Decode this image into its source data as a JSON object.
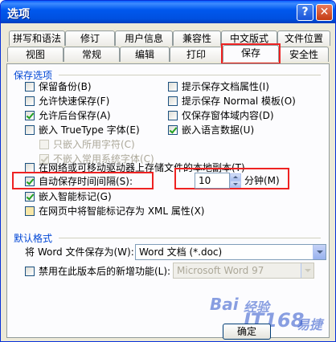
{
  "window": {
    "title": "选项",
    "help_glyph": "?",
    "close_glyph": "✕"
  },
  "tabs_row1": [
    "拼写和语法",
    "修订",
    "用户信息",
    "兼容性",
    "中文版式",
    "文件位置"
  ],
  "tabs_row2": [
    "视图",
    "常规",
    "编辑",
    "打印",
    "保存",
    "安全性"
  ],
  "active_tab": "保存",
  "save_options": {
    "group_title": "保存选项",
    "left": [
      {
        "label": "保留备份(B)",
        "checked": false,
        "disabled": false
      },
      {
        "label": "允许快速保存(F)",
        "checked": false,
        "disabled": false
      },
      {
        "label": "允许后台保存(A)",
        "checked": true,
        "disabled": false
      },
      {
        "label": "嵌入 TrueType 字体(E)",
        "checked": false,
        "disabled": false
      },
      {
        "label": "只嵌入所用字符(C)",
        "checked": false,
        "disabled": true
      },
      {
        "label": "不嵌入常用系统字体(C)",
        "checked": true,
        "disabled": true
      }
    ],
    "right": [
      {
        "label": "提示保存文档属性(I)",
        "checked": false
      },
      {
        "label": "提示保存 Normal 模板(O)",
        "checked": false
      },
      {
        "label": "仅保存窗体域内容(D)",
        "checked": false
      },
      {
        "label": "嵌入语言数据(U)",
        "checked": true
      }
    ],
    "network_copy": {
      "label": "在网络或可移动驱动器上存储文件的本地副本(T)",
      "checked": false
    },
    "autosave": {
      "label": "自动保存时间间隔(S):",
      "checked": true,
      "minutes": "10",
      "unit": "分钟(M)"
    },
    "smart_tags": {
      "label": "嵌入智能标记(G)",
      "checked": true
    },
    "xml_tags": {
      "label": "在网页中将智能标记存为 XML 属性(X)",
      "checked": false
    }
  },
  "default_format": {
    "group_title": "默认格式",
    "save_as_label": "将 Word 文件保存为(W):",
    "save_as_value": "Word 文档 (*.doc)",
    "disable_label": "禁用在此版本后的新增功能(L):",
    "disable_checked": false,
    "disable_value": "Microsoft Word 97"
  },
  "buttons": {
    "ok": "确定"
  },
  "watermark": {
    "brand": "Bai",
    "site": "经验",
    "tag": "IT168",
    "extra": "易捷"
  },
  "colors": {
    "title_blue": "#0054e3",
    "group_title": "#0046d5",
    "highlight_red": "#e22222",
    "check_green": "#21a121"
  }
}
